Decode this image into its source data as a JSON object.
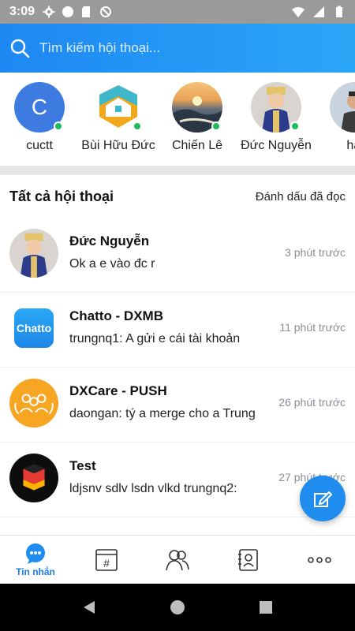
{
  "status_bar": {
    "time": "3:09",
    "icons_left": [
      "settings-icon",
      "circle-icon",
      "sdcard-icon",
      "blocked-icon"
    ],
    "icons_right": [
      "wifi-icon",
      "signal-icon",
      "battery-icon"
    ]
  },
  "search": {
    "placeholder": "Tìm kiếm hội thoại..."
  },
  "stories": [
    {
      "name": "cuctt",
      "avatar_letter": "C",
      "online": true
    },
    {
      "name": "Bùi Hữu Đức",
      "online": true
    },
    {
      "name": "Chiến Lê",
      "online": true
    },
    {
      "name": "Đức Nguyễn",
      "online": true
    },
    {
      "name": "hai",
      "online": false
    }
  ],
  "section": {
    "title": "Tất cả hội thoại",
    "mark_read": "Đánh dấu đã đọc"
  },
  "conversations": [
    {
      "name": "Đức Nguyễn",
      "message": "Ok a e vào đc r",
      "time": "3 phút trước"
    },
    {
      "name": "Chatto - DXMB",
      "message": "trungnq1: A gửi e cái tài khoản",
      "time": "11 phút trước",
      "avatar_text": "Chatto"
    },
    {
      "name": "DXCare - PUSH",
      "message": "daongan: tý a merge cho a Trung",
      "time": "26 phút trước"
    },
    {
      "name": "Test",
      "message": " ldjsnv sdlv lsdn vlkd trungnq2:",
      "time": "27 phút trước"
    }
  ],
  "bottom_nav": {
    "items": [
      {
        "label": "Tin nhắn",
        "icon": "chat-bubble-icon",
        "active": true
      },
      {
        "label": "",
        "icon": "hashtag-channel-icon",
        "active": false
      },
      {
        "label": "",
        "icon": "group-icon",
        "active": false
      },
      {
        "label": "",
        "icon": "contacts-book-icon",
        "active": false
      },
      {
        "label": "",
        "icon": "more-icon",
        "active": false
      }
    ]
  },
  "colors": {
    "accent": "#1f8cf0",
    "online": "#1fbc5b",
    "muted_text": "#8a8f96"
  }
}
